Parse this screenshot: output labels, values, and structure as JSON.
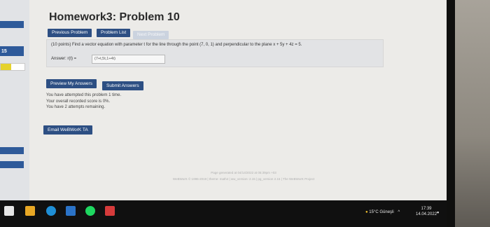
{
  "sidebar": {
    "badge_label": "15",
    "progress_fraction": 0.45
  },
  "page": {
    "title": "Homework3: Problem 10"
  },
  "nav": {
    "previous_label": "Previous Problem",
    "list_label": "Problem List",
    "next_label": "Next Problem"
  },
  "problem": {
    "text": "(10 points) Find a vector equation with parameter t for the line through the point (7, 0, 1) and perpendicular to the plane x + 5y + 4z = 5.",
    "answer_label": "Answer: r(t) =",
    "answer_value": "(7+t,5t,1+4t)"
  },
  "actions": {
    "preview_label": "Preview My Answers",
    "submit_label": "Submit Answers",
    "email_label": "Email WeBWorK TA"
  },
  "status": {
    "line1": "You have attempted this problem 1 time.",
    "line2": "Your overall recorded score is 0%.",
    "line3": "You have 2 attempts remaining."
  },
  "footer": {
    "line1": "Page generated at 04/14/2022 at 05:39pm +03",
    "line2": "WeBWorK © 1996-2019 | theme: math4 | ww_version: 2.15 | pg_version 2.15 | The WeBWorK Project"
  },
  "taskbar": {
    "weather": "15°C Güneşli",
    "time": "17:39",
    "date": "14.04.2022",
    "colors": {
      "start": "#e6e6e6",
      "explorer": "#e9a825",
      "edge": "#1f8fd6",
      "store": "#2b73c8",
      "spotify": "#1ed760",
      "app": "#d63b3b"
    }
  }
}
